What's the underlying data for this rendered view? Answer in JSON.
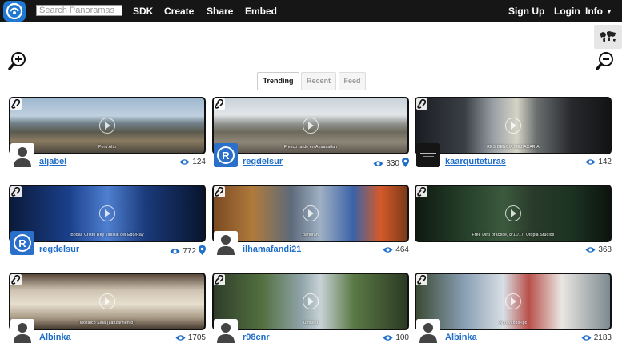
{
  "header": {
    "search_placeholder": "Search Panoramas",
    "nav": {
      "sdk": "SDK",
      "create": "Create",
      "share": "Share",
      "embed": "Embed",
      "sign_up": "Sign Up",
      "login": "Login",
      "info": "Info"
    }
  },
  "tabs": {
    "trending": "Trending",
    "recent": "Recent",
    "feed": "Feed",
    "active": "Trending"
  },
  "panoramas": [
    {
      "caption": "Peru Alto",
      "user": "aljabel",
      "views": "124",
      "has_location": false
    },
    {
      "caption": "Fresco tarde en Ahuacatlan",
      "user": "regdelsur",
      "views": "330",
      "has_location": true
    },
    {
      "caption": "RESIDENCIA MEJIAXARIA",
      "user": "kaarquiteturas",
      "views": "142",
      "has_location": false
    },
    {
      "caption": "Bodas Cristo Rey Jallsial del Edo/Ray",
      "user": "regdelsur",
      "views": "772",
      "has_location": true
    },
    {
      "caption": "parkiran",
      "user": "ilhamafandi21",
      "views": "464",
      "has_location": false
    },
    {
      "caption": "Free DirtI practice, 8/11/17, Utopia Studios",
      "user": "",
      "views": "368",
      "has_location": false
    },
    {
      "caption": "Mosaico Sala (Lanzamiento)",
      "user": "Albinka",
      "views": "1705",
      "has_location": false
    },
    {
      "caption": "Untitled",
      "user": "r98cnr",
      "views": "100",
      "has_location": false
    },
    {
      "caption": "Aprovando-ipc",
      "user": "Albinka",
      "views": "2183",
      "has_location": false
    }
  ],
  "colors": {
    "topbar": "#161616",
    "logo_blue": "#1f78d1",
    "link_blue": "#1f6ec9"
  }
}
